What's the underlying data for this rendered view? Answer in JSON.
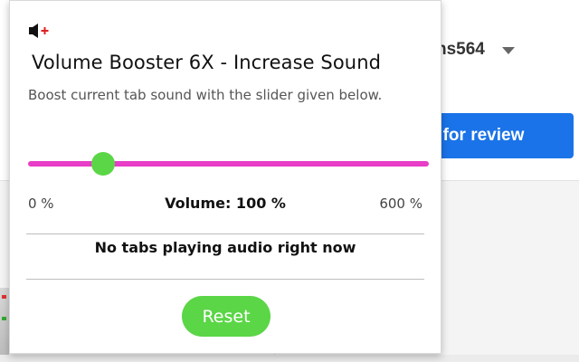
{
  "background": {
    "username_partial": "ns564",
    "submit_button_partial": "t for review",
    "colors": {
      "submit_bg": "#1a73e8"
    }
  },
  "popup": {
    "icon": "speaker-plus-icon",
    "title": "Volume Booster 6X - Increase Sound",
    "description": "Boost current tab sound with the slider given below.",
    "slider": {
      "min_label": "0 %",
      "max_label": "600 %",
      "min_value": 0,
      "max_value": 600,
      "current_value": 100,
      "track_color": "#e83dc6",
      "thumb_color": "#5bd646"
    },
    "volume_label": "Volume: 100 %",
    "status": "No tabs playing audio right now",
    "reset_label": "Reset",
    "colors": {
      "reset_bg": "#5bd646",
      "icon_plus": "#e02020"
    }
  }
}
